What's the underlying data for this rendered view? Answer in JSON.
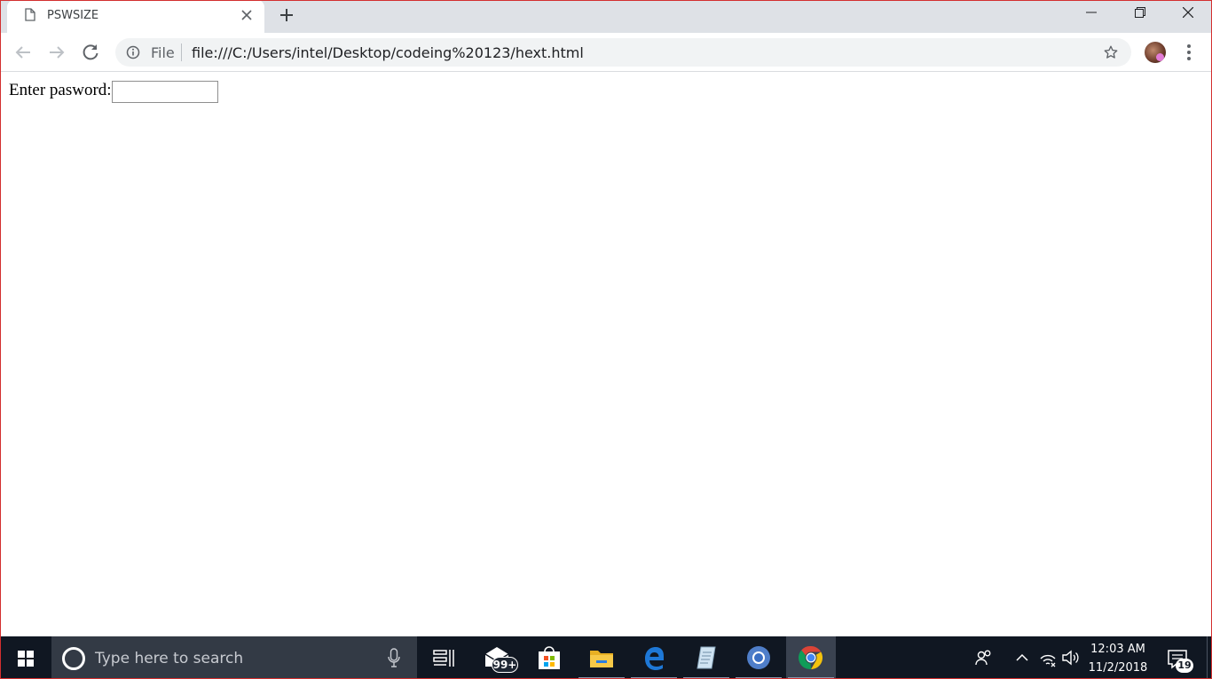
{
  "browser": {
    "tab_title": "PSWSIZE",
    "omnibox": {
      "scheme_chip": "File",
      "url": "file:///C:/Users/intel/Desktop/codeing%20123/hext.html"
    }
  },
  "page": {
    "password_label": "Enter pasword:",
    "password_value": ""
  },
  "taskbar": {
    "search_placeholder": "Type here to search",
    "mail_badge": "99+",
    "clock_time": "12:03 AM",
    "clock_date": "11/2/2018",
    "notification_count": "19"
  },
  "colors": {
    "tab_strip_bg": "#dee1e6",
    "taskbar_bg": "#101722",
    "window_border": "#d32f2f"
  }
}
